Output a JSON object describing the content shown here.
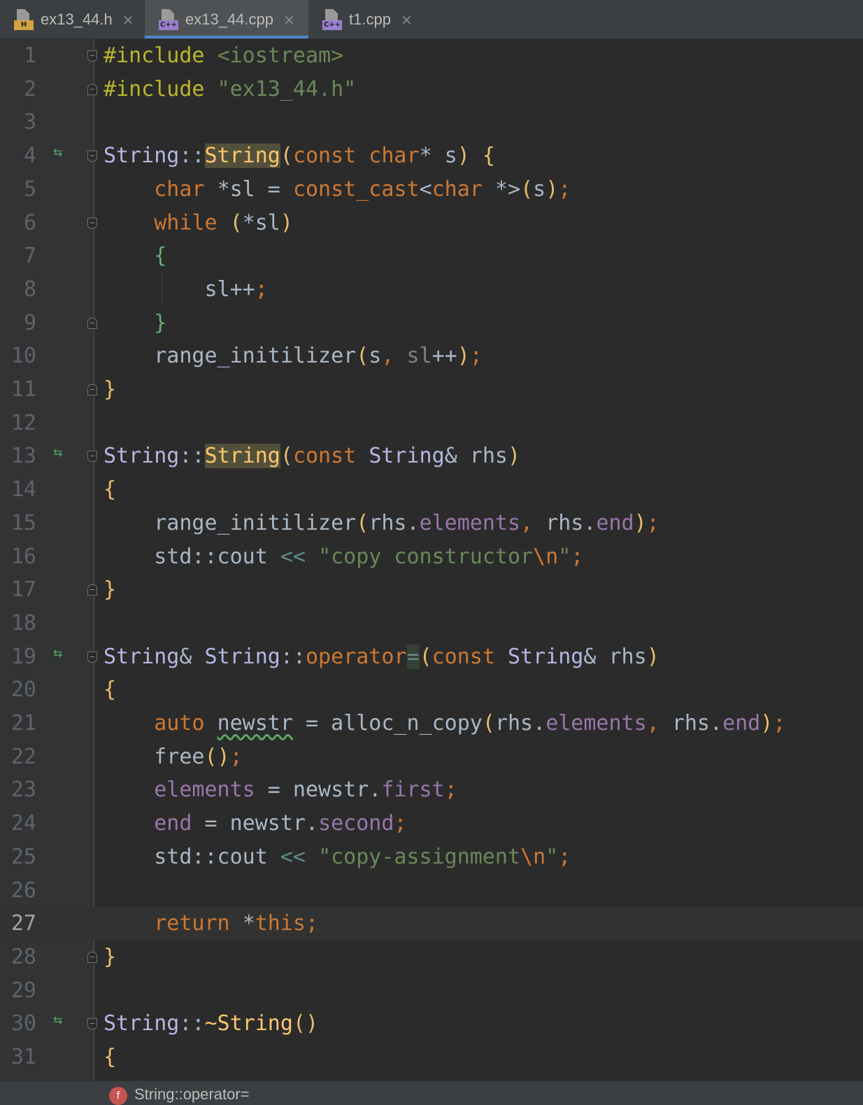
{
  "tabs": [
    {
      "name": "ex13_44.h",
      "badge": "H",
      "badge_color": "#d3a33f",
      "close_icon": "×",
      "active": false
    },
    {
      "name": "ex13_44.cpp",
      "badge": "C++",
      "badge_color": "#9a7fcf",
      "close_icon": "×",
      "active": true
    },
    {
      "name": "t1.cpp",
      "badge": "C++",
      "badge_color": "#9a7fcf",
      "close_icon": "×",
      "active": false
    }
  ],
  "editor": {
    "current_line": 27,
    "lines": [
      {
        "n": "1",
        "fold": "open",
        "code": [
          [
            "pp",
            "#include "
          ],
          [
            "str",
            "<iostream>"
          ]
        ]
      },
      {
        "n": "2",
        "fold": "close",
        "code": [
          [
            "pp",
            "#include "
          ],
          [
            "str",
            "\"ex13_44.h\""
          ]
        ]
      },
      {
        "n": "3",
        "code": []
      },
      {
        "n": "4",
        "override": true,
        "fold": "open",
        "code": [
          [
            "cls",
            "String"
          ],
          [
            "plain",
            "::"
          ],
          [
            "def-hl",
            "String"
          ],
          [
            "brace",
            "("
          ],
          [
            "kw",
            "const char"
          ],
          [
            "plain",
            "* s"
          ],
          [
            "brace",
            ")"
          ],
          [
            "plain",
            " "
          ],
          [
            "brace",
            "{"
          ]
        ]
      },
      {
        "n": "5",
        "code": [
          [
            "plain",
            "    "
          ],
          [
            "kw",
            "char "
          ],
          [
            "plain",
            "*sl = "
          ],
          [
            "kw",
            "const_cast"
          ],
          [
            "plain",
            "<"
          ],
          [
            "kw",
            "char "
          ],
          [
            "plain",
            "*>"
          ],
          [
            "brace",
            "("
          ],
          [
            "plain",
            "s"
          ],
          [
            "brace",
            ")"
          ],
          [
            "kw",
            ";"
          ]
        ]
      },
      {
        "n": "6",
        "fold": "open",
        "code": [
          [
            "plain",
            "    "
          ],
          [
            "kw",
            "while "
          ],
          [
            "brace",
            "("
          ],
          [
            "plain",
            "*sl"
          ],
          [
            "brace",
            ")"
          ]
        ]
      },
      {
        "n": "7",
        "code": [
          [
            "plain",
            "    "
          ],
          [
            "gbrace",
            "{"
          ]
        ]
      },
      {
        "n": "8",
        "guide": true,
        "code": [
          [
            "plain",
            "        sl++"
          ],
          [
            "kw",
            ";"
          ]
        ]
      },
      {
        "n": "9",
        "fold": "close",
        "code": [
          [
            "plain",
            "    "
          ],
          [
            "gbrace",
            "}"
          ]
        ]
      },
      {
        "n": "10",
        "code": [
          [
            "plain",
            "    range_initilizer"
          ],
          [
            "brace",
            "("
          ],
          [
            "plain",
            "s"
          ],
          [
            "kw",
            ", "
          ],
          [
            "dim",
            "sl"
          ],
          [
            "plain",
            "++"
          ],
          [
            "brace",
            ")"
          ],
          [
            "kw",
            ";"
          ]
        ]
      },
      {
        "n": "11",
        "fold": "close",
        "code": [
          [
            "brace",
            "}"
          ]
        ]
      },
      {
        "n": "12",
        "code": []
      },
      {
        "n": "13",
        "override": true,
        "fold": "open",
        "code": [
          [
            "cls",
            "String"
          ],
          [
            "plain",
            "::"
          ],
          [
            "def-hl",
            "String"
          ],
          [
            "brace",
            "("
          ],
          [
            "kw",
            "const "
          ],
          [
            "cls",
            "String"
          ],
          [
            "plain",
            "& rhs"
          ],
          [
            "brace",
            ")"
          ]
        ]
      },
      {
        "n": "14",
        "code": [
          [
            "brace",
            "{"
          ]
        ]
      },
      {
        "n": "15",
        "code": [
          [
            "plain",
            "    range_initilizer"
          ],
          [
            "brace",
            "("
          ],
          [
            "plain",
            "rhs."
          ],
          [
            "fld",
            "elements"
          ],
          [
            "kw",
            ", "
          ],
          [
            "plain",
            "rhs."
          ],
          [
            "fld",
            "end"
          ],
          [
            "brace",
            ")"
          ],
          [
            "kw",
            ";"
          ]
        ]
      },
      {
        "n": "16",
        "code": [
          [
            "plain",
            "    std::cout "
          ],
          [
            "op",
            "<< "
          ],
          [
            "str",
            "\"copy constructor"
          ],
          [
            "kw",
            "\\n"
          ],
          [
            "str",
            "\""
          ],
          [
            "kw",
            ";"
          ]
        ]
      },
      {
        "n": "17",
        "fold": "close",
        "code": [
          [
            "brace",
            "}"
          ]
        ]
      },
      {
        "n": "18",
        "code": []
      },
      {
        "n": "19",
        "override": true,
        "fold": "open",
        "code": [
          [
            "cls",
            "String"
          ],
          [
            "plain",
            "& "
          ],
          [
            "cls",
            "String"
          ],
          [
            "plain",
            "::"
          ],
          [
            "kw",
            "operator"
          ],
          [
            "op-hl",
            "="
          ],
          [
            "brace",
            "("
          ],
          [
            "kw",
            "const "
          ],
          [
            "cls",
            "String"
          ],
          [
            "plain",
            "& rhs"
          ],
          [
            "brace",
            ")"
          ]
        ]
      },
      {
        "n": "20",
        "code": [
          [
            "brace",
            "{"
          ]
        ]
      },
      {
        "n": "21",
        "code": [
          [
            "plain",
            "    "
          ],
          [
            "kw",
            "auto "
          ],
          [
            "squiggle",
            "newstr"
          ],
          [
            "plain",
            " = alloc_n_copy"
          ],
          [
            "brace",
            "("
          ],
          [
            "plain",
            "rhs."
          ],
          [
            "fld",
            "elements"
          ],
          [
            "kw",
            ", "
          ],
          [
            "plain",
            "rhs."
          ],
          [
            "fld",
            "end"
          ],
          [
            "brace",
            ")"
          ],
          [
            "kw",
            ";"
          ]
        ]
      },
      {
        "n": "22",
        "code": [
          [
            "plain",
            "    free"
          ],
          [
            "brace",
            "()"
          ],
          [
            "kw",
            ";"
          ]
        ]
      },
      {
        "n": "23",
        "code": [
          [
            "plain",
            "    "
          ],
          [
            "fld",
            "elements"
          ],
          [
            "plain",
            " = newstr."
          ],
          [
            "fld",
            "first"
          ],
          [
            "kw",
            ";"
          ]
        ]
      },
      {
        "n": "24",
        "code": [
          [
            "plain",
            "    "
          ],
          [
            "fld",
            "end"
          ],
          [
            "plain",
            " = newstr."
          ],
          [
            "fld",
            "second"
          ],
          [
            "kw",
            ";"
          ]
        ]
      },
      {
        "n": "25",
        "code": [
          [
            "plain",
            "    std::cout "
          ],
          [
            "op",
            "<< "
          ],
          [
            "str",
            "\"copy-assignment"
          ],
          [
            "kw",
            "\\n"
          ],
          [
            "str",
            "\""
          ],
          [
            "kw",
            ";"
          ]
        ]
      },
      {
        "n": "26",
        "code": []
      },
      {
        "n": "27",
        "code": [
          [
            "plain",
            "    "
          ],
          [
            "kw",
            "return "
          ],
          [
            "plain",
            "*"
          ],
          [
            "kw",
            "this;"
          ]
        ]
      },
      {
        "n": "28",
        "fold": "close",
        "code": [
          [
            "brace",
            "}"
          ]
        ]
      },
      {
        "n": "29",
        "code": []
      },
      {
        "n": "30",
        "override": true,
        "fold": "open",
        "code": [
          [
            "cls",
            "String"
          ],
          [
            "plain",
            "::"
          ],
          [
            "def",
            "~String"
          ],
          [
            "brace",
            "()"
          ]
        ]
      },
      {
        "n": "31",
        "code": [
          [
            "brace",
            "{"
          ]
        ]
      }
    ]
  },
  "breadcrumb": {
    "icon": "f",
    "text": "String::operator="
  },
  "colors": {
    "keyword": "#cc7832",
    "string": "#6a8759",
    "class": "#b5b6e3",
    "field": "#9876aa",
    "function_def": "#ffc66d",
    "preprocessor": "#bbb529"
  }
}
